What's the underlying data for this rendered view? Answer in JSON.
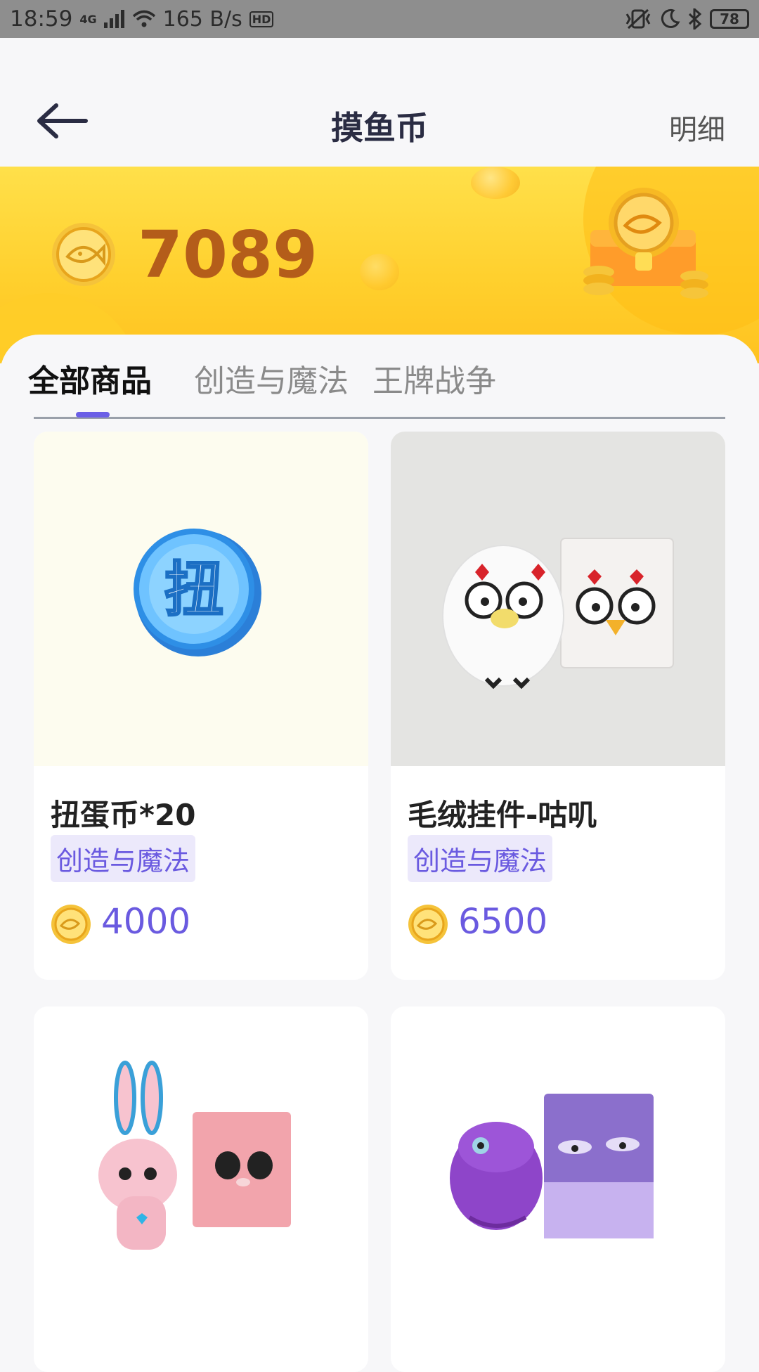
{
  "status_bar": {
    "time": "18:59",
    "network": "4G",
    "speed": "165 B/s",
    "hd": "HD",
    "battery": "78"
  },
  "header": {
    "title": "摸鱼币",
    "detail_label": "明细"
  },
  "balance": {
    "amount": "7089"
  },
  "tabs": [
    {
      "label": "全部商品",
      "active": true
    },
    {
      "label": "创造与魔法",
      "active": false
    },
    {
      "label": "王牌战争",
      "active": false
    }
  ],
  "products": [
    {
      "name": "扭蛋币*20",
      "tag": "创造与魔法",
      "price": "4000",
      "image": "blue-token-icon",
      "image_glyph": "扭"
    },
    {
      "name": "毛绒挂件-咕叽",
      "tag": "创造与魔法",
      "price": "6500",
      "image": "white-bird-plush"
    },
    {
      "name": "",
      "tag": "",
      "price": "",
      "image": "pink-bunny-plush"
    },
    {
      "name": "",
      "tag": "",
      "price": "",
      "image": "purple-dino-plush"
    }
  ],
  "colors": {
    "accent": "#6a5ae0",
    "banner": "#ffcf2c",
    "balance_text": "#b45d1a"
  }
}
